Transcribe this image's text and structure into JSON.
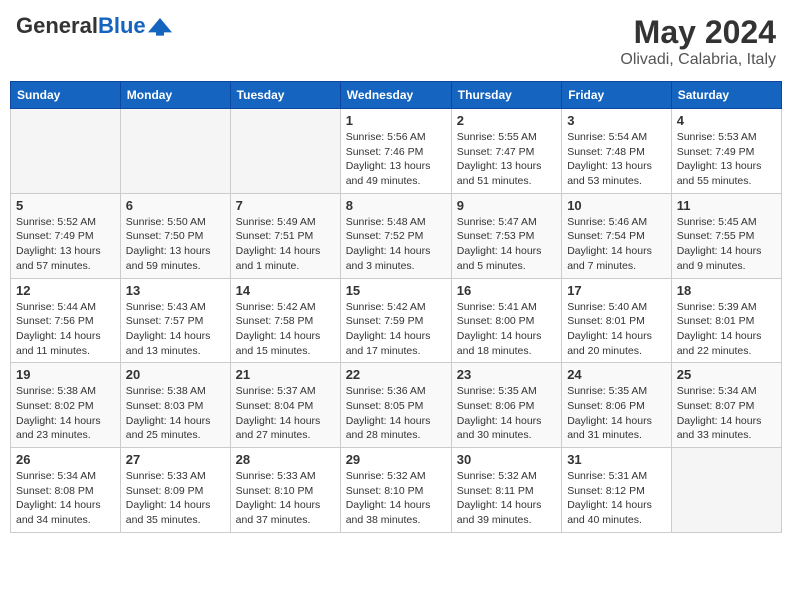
{
  "header": {
    "logo_general": "General",
    "logo_blue": "Blue",
    "month_title": "May 2024",
    "location": "Olivadi, Calabria, Italy"
  },
  "days_of_week": [
    "Sunday",
    "Monday",
    "Tuesday",
    "Wednesday",
    "Thursday",
    "Friday",
    "Saturday"
  ],
  "weeks": [
    [
      {
        "day": "",
        "info": ""
      },
      {
        "day": "",
        "info": ""
      },
      {
        "day": "",
        "info": ""
      },
      {
        "day": "1",
        "info": "Sunrise: 5:56 AM\nSunset: 7:46 PM\nDaylight: 13 hours\nand 49 minutes."
      },
      {
        "day": "2",
        "info": "Sunrise: 5:55 AM\nSunset: 7:47 PM\nDaylight: 13 hours\nand 51 minutes."
      },
      {
        "day": "3",
        "info": "Sunrise: 5:54 AM\nSunset: 7:48 PM\nDaylight: 13 hours\nand 53 minutes."
      },
      {
        "day": "4",
        "info": "Sunrise: 5:53 AM\nSunset: 7:49 PM\nDaylight: 13 hours\nand 55 minutes."
      }
    ],
    [
      {
        "day": "5",
        "info": "Sunrise: 5:52 AM\nSunset: 7:49 PM\nDaylight: 13 hours\nand 57 minutes."
      },
      {
        "day": "6",
        "info": "Sunrise: 5:50 AM\nSunset: 7:50 PM\nDaylight: 13 hours\nand 59 minutes."
      },
      {
        "day": "7",
        "info": "Sunrise: 5:49 AM\nSunset: 7:51 PM\nDaylight: 14 hours\nand 1 minute."
      },
      {
        "day": "8",
        "info": "Sunrise: 5:48 AM\nSunset: 7:52 PM\nDaylight: 14 hours\nand 3 minutes."
      },
      {
        "day": "9",
        "info": "Sunrise: 5:47 AM\nSunset: 7:53 PM\nDaylight: 14 hours\nand 5 minutes."
      },
      {
        "day": "10",
        "info": "Sunrise: 5:46 AM\nSunset: 7:54 PM\nDaylight: 14 hours\nand 7 minutes."
      },
      {
        "day": "11",
        "info": "Sunrise: 5:45 AM\nSunset: 7:55 PM\nDaylight: 14 hours\nand 9 minutes."
      }
    ],
    [
      {
        "day": "12",
        "info": "Sunrise: 5:44 AM\nSunset: 7:56 PM\nDaylight: 14 hours\nand 11 minutes."
      },
      {
        "day": "13",
        "info": "Sunrise: 5:43 AM\nSunset: 7:57 PM\nDaylight: 14 hours\nand 13 minutes."
      },
      {
        "day": "14",
        "info": "Sunrise: 5:42 AM\nSunset: 7:58 PM\nDaylight: 14 hours\nand 15 minutes."
      },
      {
        "day": "15",
        "info": "Sunrise: 5:42 AM\nSunset: 7:59 PM\nDaylight: 14 hours\nand 17 minutes."
      },
      {
        "day": "16",
        "info": "Sunrise: 5:41 AM\nSunset: 8:00 PM\nDaylight: 14 hours\nand 18 minutes."
      },
      {
        "day": "17",
        "info": "Sunrise: 5:40 AM\nSunset: 8:01 PM\nDaylight: 14 hours\nand 20 minutes."
      },
      {
        "day": "18",
        "info": "Sunrise: 5:39 AM\nSunset: 8:01 PM\nDaylight: 14 hours\nand 22 minutes."
      }
    ],
    [
      {
        "day": "19",
        "info": "Sunrise: 5:38 AM\nSunset: 8:02 PM\nDaylight: 14 hours\nand 23 minutes."
      },
      {
        "day": "20",
        "info": "Sunrise: 5:38 AM\nSunset: 8:03 PM\nDaylight: 14 hours\nand 25 minutes."
      },
      {
        "day": "21",
        "info": "Sunrise: 5:37 AM\nSunset: 8:04 PM\nDaylight: 14 hours\nand 27 minutes."
      },
      {
        "day": "22",
        "info": "Sunrise: 5:36 AM\nSunset: 8:05 PM\nDaylight: 14 hours\nand 28 minutes."
      },
      {
        "day": "23",
        "info": "Sunrise: 5:35 AM\nSunset: 8:06 PM\nDaylight: 14 hours\nand 30 minutes."
      },
      {
        "day": "24",
        "info": "Sunrise: 5:35 AM\nSunset: 8:06 PM\nDaylight: 14 hours\nand 31 minutes."
      },
      {
        "day": "25",
        "info": "Sunrise: 5:34 AM\nSunset: 8:07 PM\nDaylight: 14 hours\nand 33 minutes."
      }
    ],
    [
      {
        "day": "26",
        "info": "Sunrise: 5:34 AM\nSunset: 8:08 PM\nDaylight: 14 hours\nand 34 minutes."
      },
      {
        "day": "27",
        "info": "Sunrise: 5:33 AM\nSunset: 8:09 PM\nDaylight: 14 hours\nand 35 minutes."
      },
      {
        "day": "28",
        "info": "Sunrise: 5:33 AM\nSunset: 8:10 PM\nDaylight: 14 hours\nand 37 minutes."
      },
      {
        "day": "29",
        "info": "Sunrise: 5:32 AM\nSunset: 8:10 PM\nDaylight: 14 hours\nand 38 minutes."
      },
      {
        "day": "30",
        "info": "Sunrise: 5:32 AM\nSunset: 8:11 PM\nDaylight: 14 hours\nand 39 minutes."
      },
      {
        "day": "31",
        "info": "Sunrise: 5:31 AM\nSunset: 8:12 PM\nDaylight: 14 hours\nand 40 minutes."
      },
      {
        "day": "",
        "info": ""
      }
    ]
  ]
}
